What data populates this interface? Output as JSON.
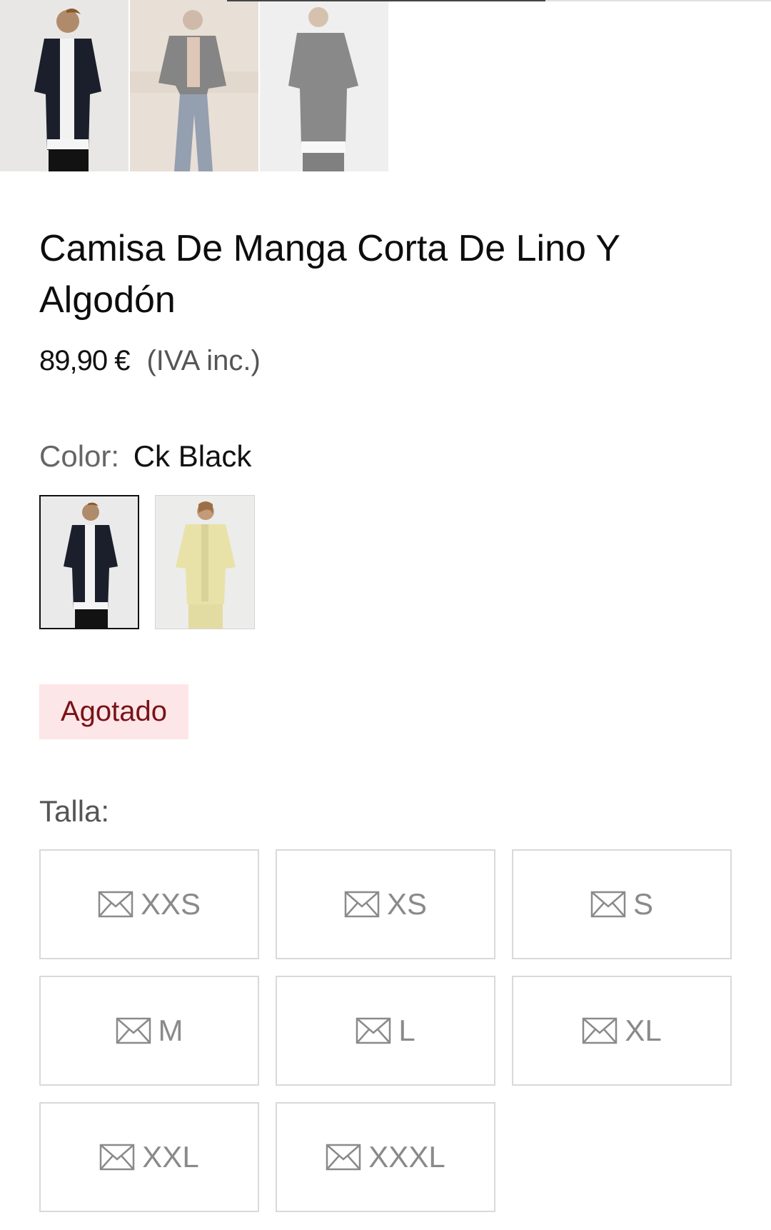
{
  "product": {
    "title": "Camisa De Manga Corta De Lino Y Algodón",
    "price": "89,90 €",
    "tax_note": "(IVA inc.)",
    "color_label": "Color:",
    "color_value": "Ck Black",
    "stock_status": "Agotado",
    "size_label": "Talla:"
  },
  "sizes": [
    "XXS",
    "XS",
    "S",
    "M",
    "L",
    "XL",
    "XXL",
    "XXXL"
  ],
  "colors": {
    "sold_out_bg": "#fde6e7",
    "sold_out_text": "#7a1218",
    "size_text": "#8a8a8a",
    "size_border": "#d9d9d9"
  },
  "icons": {
    "size_notify": "envelope-icon"
  }
}
